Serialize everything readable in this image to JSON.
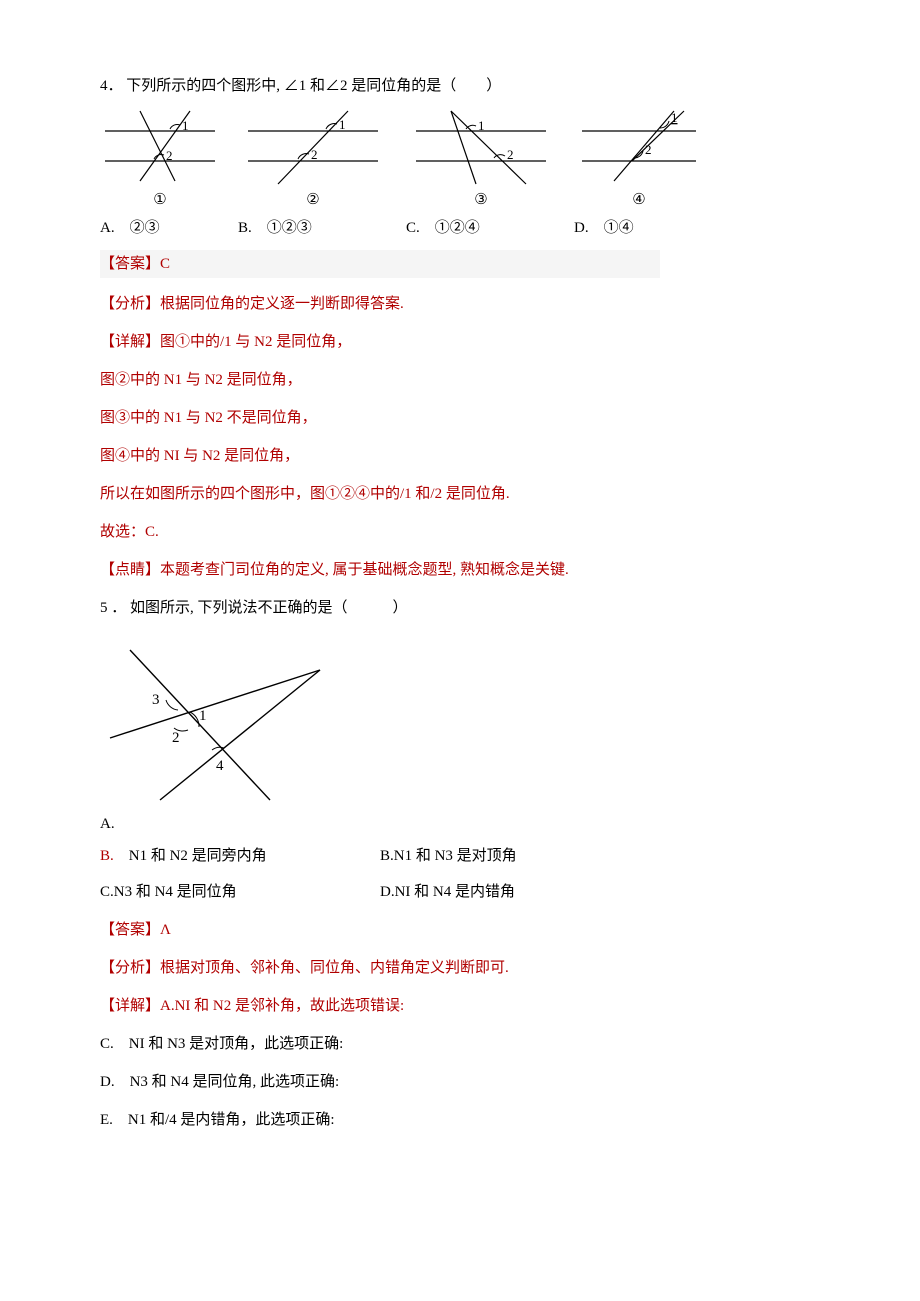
{
  "q4": {
    "number": "4．",
    "stem": "下列所示的四个图形中, ∠1 和∠2 是同位角的是（　　）",
    "fig_labels": {
      "a": "①",
      "b": "②",
      "c": "③",
      "d": "④"
    },
    "options": {
      "a": "A.　②③",
      "b": "B.　①②③",
      "c": "C.　①②④",
      "d": "D.　①④"
    },
    "answer": "【答案】C",
    "analysis_label": "【分析】",
    "analysis_text": "根据同位角的定义逐一判断即得答案.",
    "detail_label": "【详解】",
    "detail_1": "图①中的/1 与 N2 是同位角，",
    "detail_2": "图②中的 N1 与 N2 是同位角，",
    "detail_3": "图③中的 N1 与 N2 不是同位角，",
    "detail_4": "图④中的 NI 与 N2 是同位角，",
    "detail_5": "所以在如图所示的四个图形中，图①②④中的/1 和/2 是同位角.",
    "detail_6": "故选：C.",
    "point_label": "【点睛】",
    "point_text": "本题考查门司位角的定义, 属于基础概念题型, 熟知概念是关键."
  },
  "q5": {
    "number": "5 ．",
    "stem": "如图所示, 下列说法不正确的是（　　　）",
    "opt_a_label": "A.",
    "options": {
      "a_text": "B.　N1 和 N2 是同旁内角",
      "b": "B.N1 和 N3 是对顶角",
      "c": "C.N3 和 N4 是同位角",
      "d": "D.NI 和 N4 是内错角"
    },
    "answer": "【答案】Λ",
    "analysis_label": "【分析】",
    "analysis_text": "根据对顶角、邻补角、同位角、内错角定义判断即可.",
    "detail_label": "【详解】",
    "detail_a": "A.NI 和 N2 是邻补角，故此选项错误:",
    "detail_c": "C.　NI 和 N3 是对顶角，此选项正确:",
    "detail_d": "D.　N3 和 N4 是同位角, 此选项正确:",
    "detail_e": "E.　N1 和/4 是内错角，此选项正确:"
  },
  "svg_angles": {
    "one": "1",
    "two": "2",
    "three": "3",
    "four": "4"
  }
}
